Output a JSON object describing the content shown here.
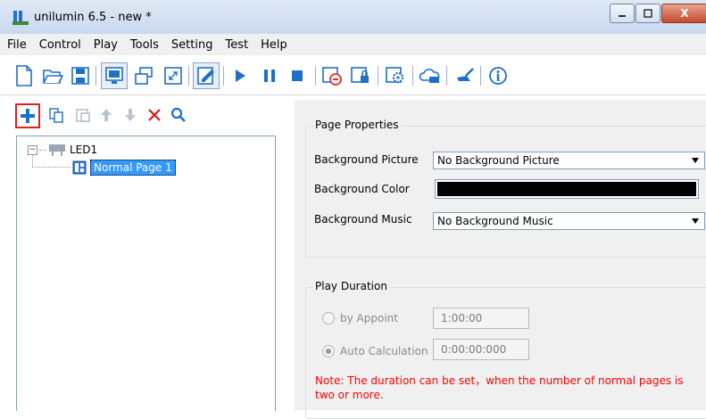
{
  "window": {
    "title": "unilumin 6.5 - new *",
    "minimize_label": "",
    "maximize_label": "",
    "close_label": "X"
  },
  "menu": {
    "items": [
      "File",
      "Control",
      "Play",
      "Tools",
      "Setting",
      "Test",
      "Help"
    ]
  },
  "toolbar": {
    "icons": [
      "new-file-icon",
      "open-folder-icon",
      "save-icon",
      "screen-icon",
      "window-icon",
      "fullscreen-icon",
      "edit-icon",
      "play-icon",
      "pause-icon",
      "stop-icon",
      "timer-icon",
      "lock-icon",
      "settings-icon",
      "cloud-icon",
      "brush-icon",
      "info-icon"
    ]
  },
  "left_toolbar": {
    "icons": [
      "add-icon",
      "copy-icon",
      "paste-icon",
      "move-up-icon",
      "move-down-icon",
      "delete-icon",
      "search-icon"
    ]
  },
  "tree": {
    "root_label": "LED1",
    "child_label": "Normal Page 1",
    "expander": "−"
  },
  "page_properties": {
    "title": "Page Properties",
    "bg_picture_label": "Background Picture",
    "bg_picture_value": "No Background Picture",
    "bg_color_label": "Background Color",
    "bg_color_value": "#000000",
    "bg_music_label": "Background Music",
    "bg_music_value": "No Background Music"
  },
  "play_duration": {
    "title": "Play Duration",
    "by_appoint_label": "by Appoint",
    "by_appoint_value": "1:00:00",
    "auto_calc_label": "Auto Calculation",
    "auto_calc_value": "0:00:00:000",
    "note": "Note: The duration can be set，when the number of normal pages is two or more."
  },
  "colors": {
    "selection": "#3399ff",
    "accent_blue": "#1e6fc8",
    "note_red": "#ff0000",
    "highlight_border": "#e02020"
  }
}
